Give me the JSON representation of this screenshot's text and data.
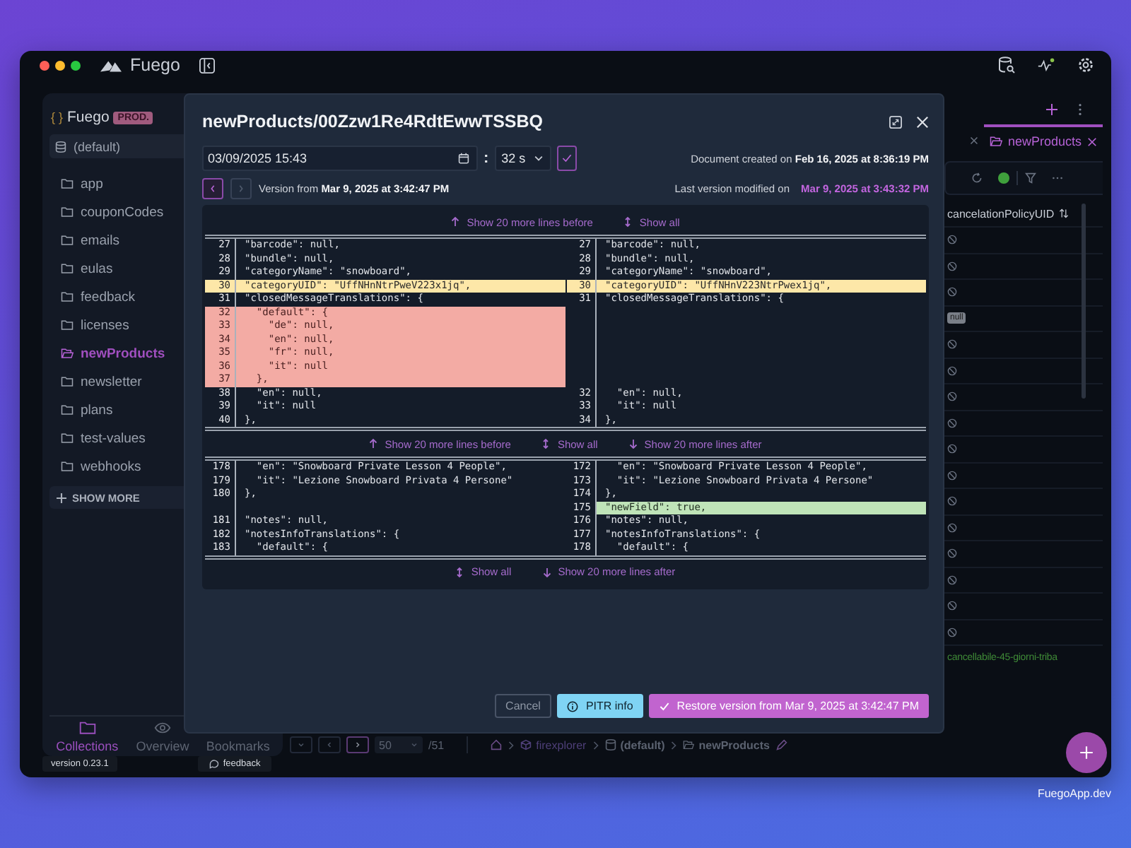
{
  "window": {
    "app_name": "Fuego"
  },
  "sidebar": {
    "project_icon": "{ }",
    "project": "Fuego",
    "environment": "PROD.",
    "database": "(default)",
    "collections": [
      {
        "name": "app",
        "selected": false
      },
      {
        "name": "couponCodes",
        "selected": false
      },
      {
        "name": "emails",
        "selected": false
      },
      {
        "name": "eulas",
        "selected": false
      },
      {
        "name": "feedback",
        "selected": false
      },
      {
        "name": "licenses",
        "selected": false
      },
      {
        "name": "newProducts",
        "selected": true
      },
      {
        "name": "newsletter",
        "selected": false
      },
      {
        "name": "plans",
        "selected": false
      },
      {
        "name": "test-values",
        "selected": false
      },
      {
        "name": "webhooks",
        "selected": false
      }
    ],
    "show_more": "SHOW MORE",
    "nav_tabs": [
      {
        "kind": "collections",
        "label": "Collections",
        "selected": true
      },
      {
        "kind": "overview",
        "label": "Overview",
        "selected": false
      },
      {
        "kind": "bookmarks",
        "label": "Bookmarks",
        "selected": false
      }
    ]
  },
  "footer": {
    "version": "version 0.23.1",
    "feedback": "feedback"
  },
  "document_tab": {
    "label": "newProducts",
    "selected": true
  },
  "table": {
    "column": "cancelationPolicyUID",
    "rows": [
      {
        "kind": "null"
      },
      {
        "kind": "null"
      },
      {
        "kind": "null"
      },
      {
        "kind": "badge",
        "text": "null"
      },
      {
        "kind": "null"
      },
      {
        "kind": "null"
      },
      {
        "kind": "null"
      },
      {
        "kind": "null"
      },
      {
        "kind": "null"
      },
      {
        "kind": "null"
      },
      {
        "kind": "null"
      },
      {
        "kind": "null"
      },
      {
        "kind": "null"
      },
      {
        "kind": "null"
      },
      {
        "kind": "null"
      },
      {
        "kind": "null"
      },
      {
        "kind": "text",
        "text": "cancellabile-45-giorni-triba"
      }
    ]
  },
  "pagination": {
    "page_size": "50",
    "total": "/51"
  },
  "breadcrumb": [
    {
      "kind": "home"
    },
    {
      "kind": "project",
      "label": "firexplorer"
    },
    {
      "kind": "database",
      "label": "(default)"
    },
    {
      "kind": "collection",
      "label": "newProducts"
    }
  ],
  "modal": {
    "title": "newProducts/00Zzw1Re4RdtEwwTSSBQ",
    "date_value": "03/09/2025 15:43",
    "separator": ":",
    "seconds": "32 s",
    "created": "Document created on **Feb 16, 2025 at 8:36:19 PM**",
    "prev_disabled": false,
    "next_disabled": true,
    "version": "Version from **Mar 9, 2025 at 3:42:47 PM**",
    "last_modified_label": "Last version modified on",
    "last_modified": "Mar 9, 2025 at 3:43:32 PM",
    "diff": [
      {
        "kind": "expander",
        "links": [
          {
            "kind": "before",
            "label": "Show 20 more lines before"
          },
          {
            "kind": "all",
            "label": "Show all"
          }
        ]
      },
      {
        "kind": "hunk",
        "rows": [
          {
            "kind": "context",
            "left_num": "27",
            "left": "\"barcode\": null,",
            "right_num": "27",
            "right": "\"barcode\": null,"
          },
          {
            "kind": "context",
            "left_num": "28",
            "left": "\"bundle\": null,",
            "right_num": "28",
            "right": "\"bundle\": null,"
          },
          {
            "kind": "context",
            "left_num": "29",
            "left": "\"categoryName\": \"snowboard\",",
            "right_num": "29",
            "right": "\"categoryName\": \"snowboard\","
          },
          {
            "kind": "changed",
            "left_num": "30",
            "left": "\"categoryUID\": \"UffNHnNtrPweV223x1jq\",",
            "right_num": "30",
            "right": "\"categoryUID\": \"UffNHnV223NtrPwex1jq\","
          },
          {
            "kind": "context",
            "left_num": "31",
            "left": "\"closedMessageTranslations\": {",
            "right_num": "31",
            "right": "\"closedMessageTranslations\": {"
          },
          {
            "kind": "removed",
            "left_num": "32",
            "left": "  \"default\": {"
          },
          {
            "kind": "removed",
            "left_num": "33",
            "left": "    \"de\": null,"
          },
          {
            "kind": "removed",
            "left_num": "34",
            "left": "    \"en\": null,"
          },
          {
            "kind": "removed",
            "left_num": "35",
            "left": "    \"fr\": null,"
          },
          {
            "kind": "removed",
            "left_num": "36",
            "left": "    \"it\": null"
          },
          {
            "kind": "removed",
            "left_num": "37",
            "left": "  },"
          },
          {
            "kind": "context",
            "left_num": "38",
            "left": "  \"en\": null,",
            "right_num": "32",
            "right": "  \"en\": null,"
          },
          {
            "kind": "context",
            "left_num": "39",
            "left": "  \"it\": null",
            "right_num": "33",
            "right": "  \"it\": null"
          },
          {
            "kind": "context",
            "left_num": "40",
            "left": "},",
            "right_num": "34",
            "right": "},"
          }
        ]
      },
      {
        "kind": "expander",
        "links": [
          {
            "kind": "before",
            "label": "Show 20 more lines before"
          },
          {
            "kind": "all",
            "label": "Show all"
          },
          {
            "kind": "after",
            "label": "Show 20 more lines after"
          }
        ]
      },
      {
        "kind": "hunk",
        "rows": [
          {
            "kind": "context",
            "left_num": "178",
            "left": "  \"en\": \"Snowboard Private Lesson 4 People\",",
            "right_num": "172",
            "right": "  \"en\": \"Snowboard Private Lesson 4 People\","
          },
          {
            "kind": "context",
            "left_num": "179",
            "left": "  \"it\": \"Lezione Snowboard Privata 4 Persone\"",
            "right_num": "173",
            "right": "  \"it\": \"Lezione Snowboard Privata 4 Persone\""
          },
          {
            "kind": "context",
            "left_num": "180",
            "left": "},",
            "right_num": "174",
            "right": "},"
          },
          {
            "kind": "added",
            "right_num": "175",
            "right": "\"newField\": true,"
          },
          {
            "kind": "context",
            "left_num": "181",
            "left": "\"notes\": null,",
            "right_num": "176",
            "right": "\"notes\": null,"
          },
          {
            "kind": "context",
            "left_num": "182",
            "left": "\"notesInfoTranslations\": {",
            "right_num": "177",
            "right": "\"notesInfoTranslations\": {"
          },
          {
            "kind": "context",
            "left_num": "183",
            "left": "  \"default\": {",
            "right_num": "178",
            "right": "  \"default\": {"
          }
        ]
      },
      {
        "kind": "expander",
        "links": [
          {
            "kind": "all",
            "label": "Show all"
          },
          {
            "kind": "after",
            "label": "Show 20 more lines after"
          }
        ]
      }
    ],
    "buttons": [
      {
        "kind": "cancel",
        "label": "Cancel"
      },
      {
        "kind": "info",
        "label": "PITR info"
      },
      {
        "kind": "restore",
        "label": "Restore version from Mar 9, 2025 at 3:42:47 PM"
      }
    ]
  },
  "promo": "FuegoApp.dev"
}
